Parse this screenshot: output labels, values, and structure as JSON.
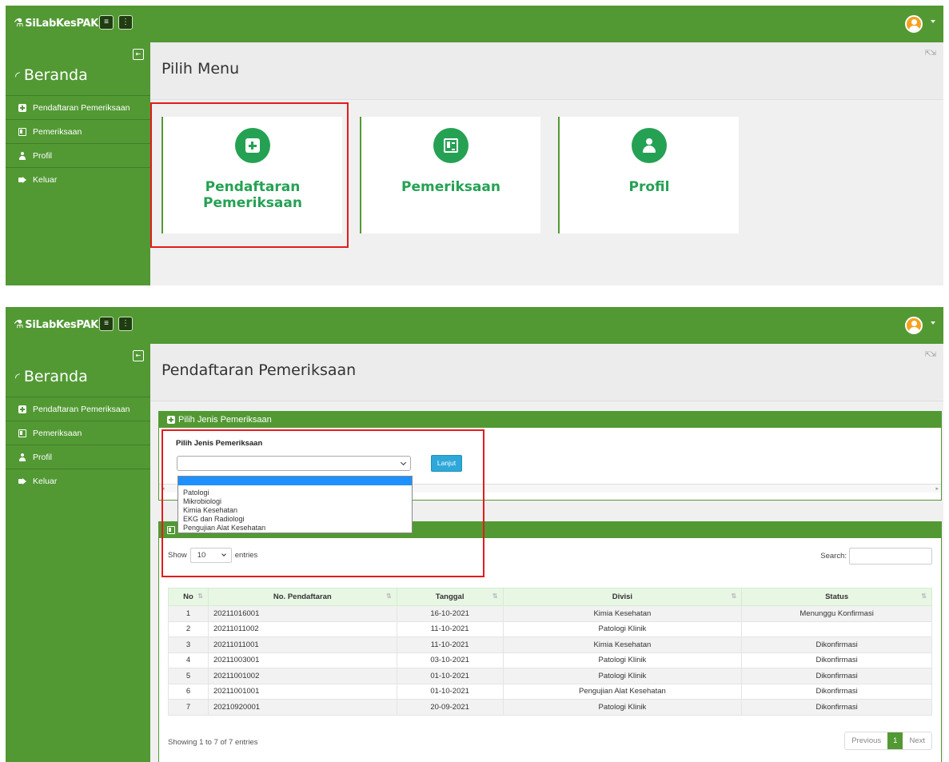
{
  "app": {
    "brand": "SiLabKesPAK"
  },
  "sidebar": {
    "home": "Beranda",
    "items": [
      {
        "label": "Pendaftaran Pemeriksaan",
        "icon": "plus-square-icon"
      },
      {
        "label": "Pemeriksaan",
        "icon": "id-card-icon"
      },
      {
        "label": "Profil",
        "icon": "user-icon"
      },
      {
        "label": "Keluar",
        "icon": "sign-out-icon"
      }
    ]
  },
  "menu_page": {
    "title": "Pilih Menu",
    "tiles": [
      {
        "label": "Pendaftaran Pemeriksaan",
        "icon": "plus-square-icon"
      },
      {
        "label": "Pemeriksaan",
        "icon": "id-card-icon"
      },
      {
        "label": "Profil",
        "icon": "user-icon"
      }
    ]
  },
  "registration_page": {
    "title": "Pendaftaran Pemeriksaan",
    "form_panel": {
      "header": "Pilih Jenis Pemeriksaan",
      "label": "Pilih Jenis Pemeriksaan",
      "select_value": "",
      "submit": "Lanjut",
      "options": [
        "",
        "Patologi",
        "Mikrobiologi",
        "Kimia Kesehatan",
        "EKG dan Radiologi",
        "Pengujian Alat Kesehatan"
      ]
    },
    "list_panel": {
      "show_prefix": "Show",
      "show_value": "10",
      "show_suffix": "entries",
      "search_label": "Search:",
      "columns": [
        "No",
        "No. Pendaftaran",
        "Tanggal",
        "Divisi",
        "Status"
      ],
      "rows": [
        [
          "1",
          "20211016001",
          "16-10-2021",
          "Kimia Kesehatan",
          "Menunggu Konfirmasi"
        ],
        [
          "2",
          "20211011002",
          "11-10-2021",
          "Patologi Klinik",
          ""
        ],
        [
          "3",
          "20211011001",
          "11-10-2021",
          "Kimia Kesehatan",
          "Dikonfirmasi"
        ],
        [
          "4",
          "20211003001",
          "03-10-2021",
          "Patologi Klinik",
          "Dikonfirmasi"
        ],
        [
          "5",
          "20211001002",
          "01-10-2021",
          "Patologi Klinik",
          "Dikonfirmasi"
        ],
        [
          "6",
          "20211001001",
          "01-10-2021",
          "Pengujian Alat Kesehatan",
          "Dikonfirmasi"
        ],
        [
          "7",
          "20210920001",
          "20-09-2021",
          "Patologi Klinik",
          "Dikonfirmasi"
        ]
      ],
      "info": "Showing 1 to 7 of 7 entries",
      "pager": {
        "previous": "Previous",
        "current": "1",
        "next": "Next"
      }
    }
  },
  "colors": {
    "brand_green": "#529934",
    "tile_green": "#25a154",
    "highlight_red": "#e41b1b",
    "select_blue": "#1e90ff",
    "button_blue": "#2ea8d8"
  }
}
